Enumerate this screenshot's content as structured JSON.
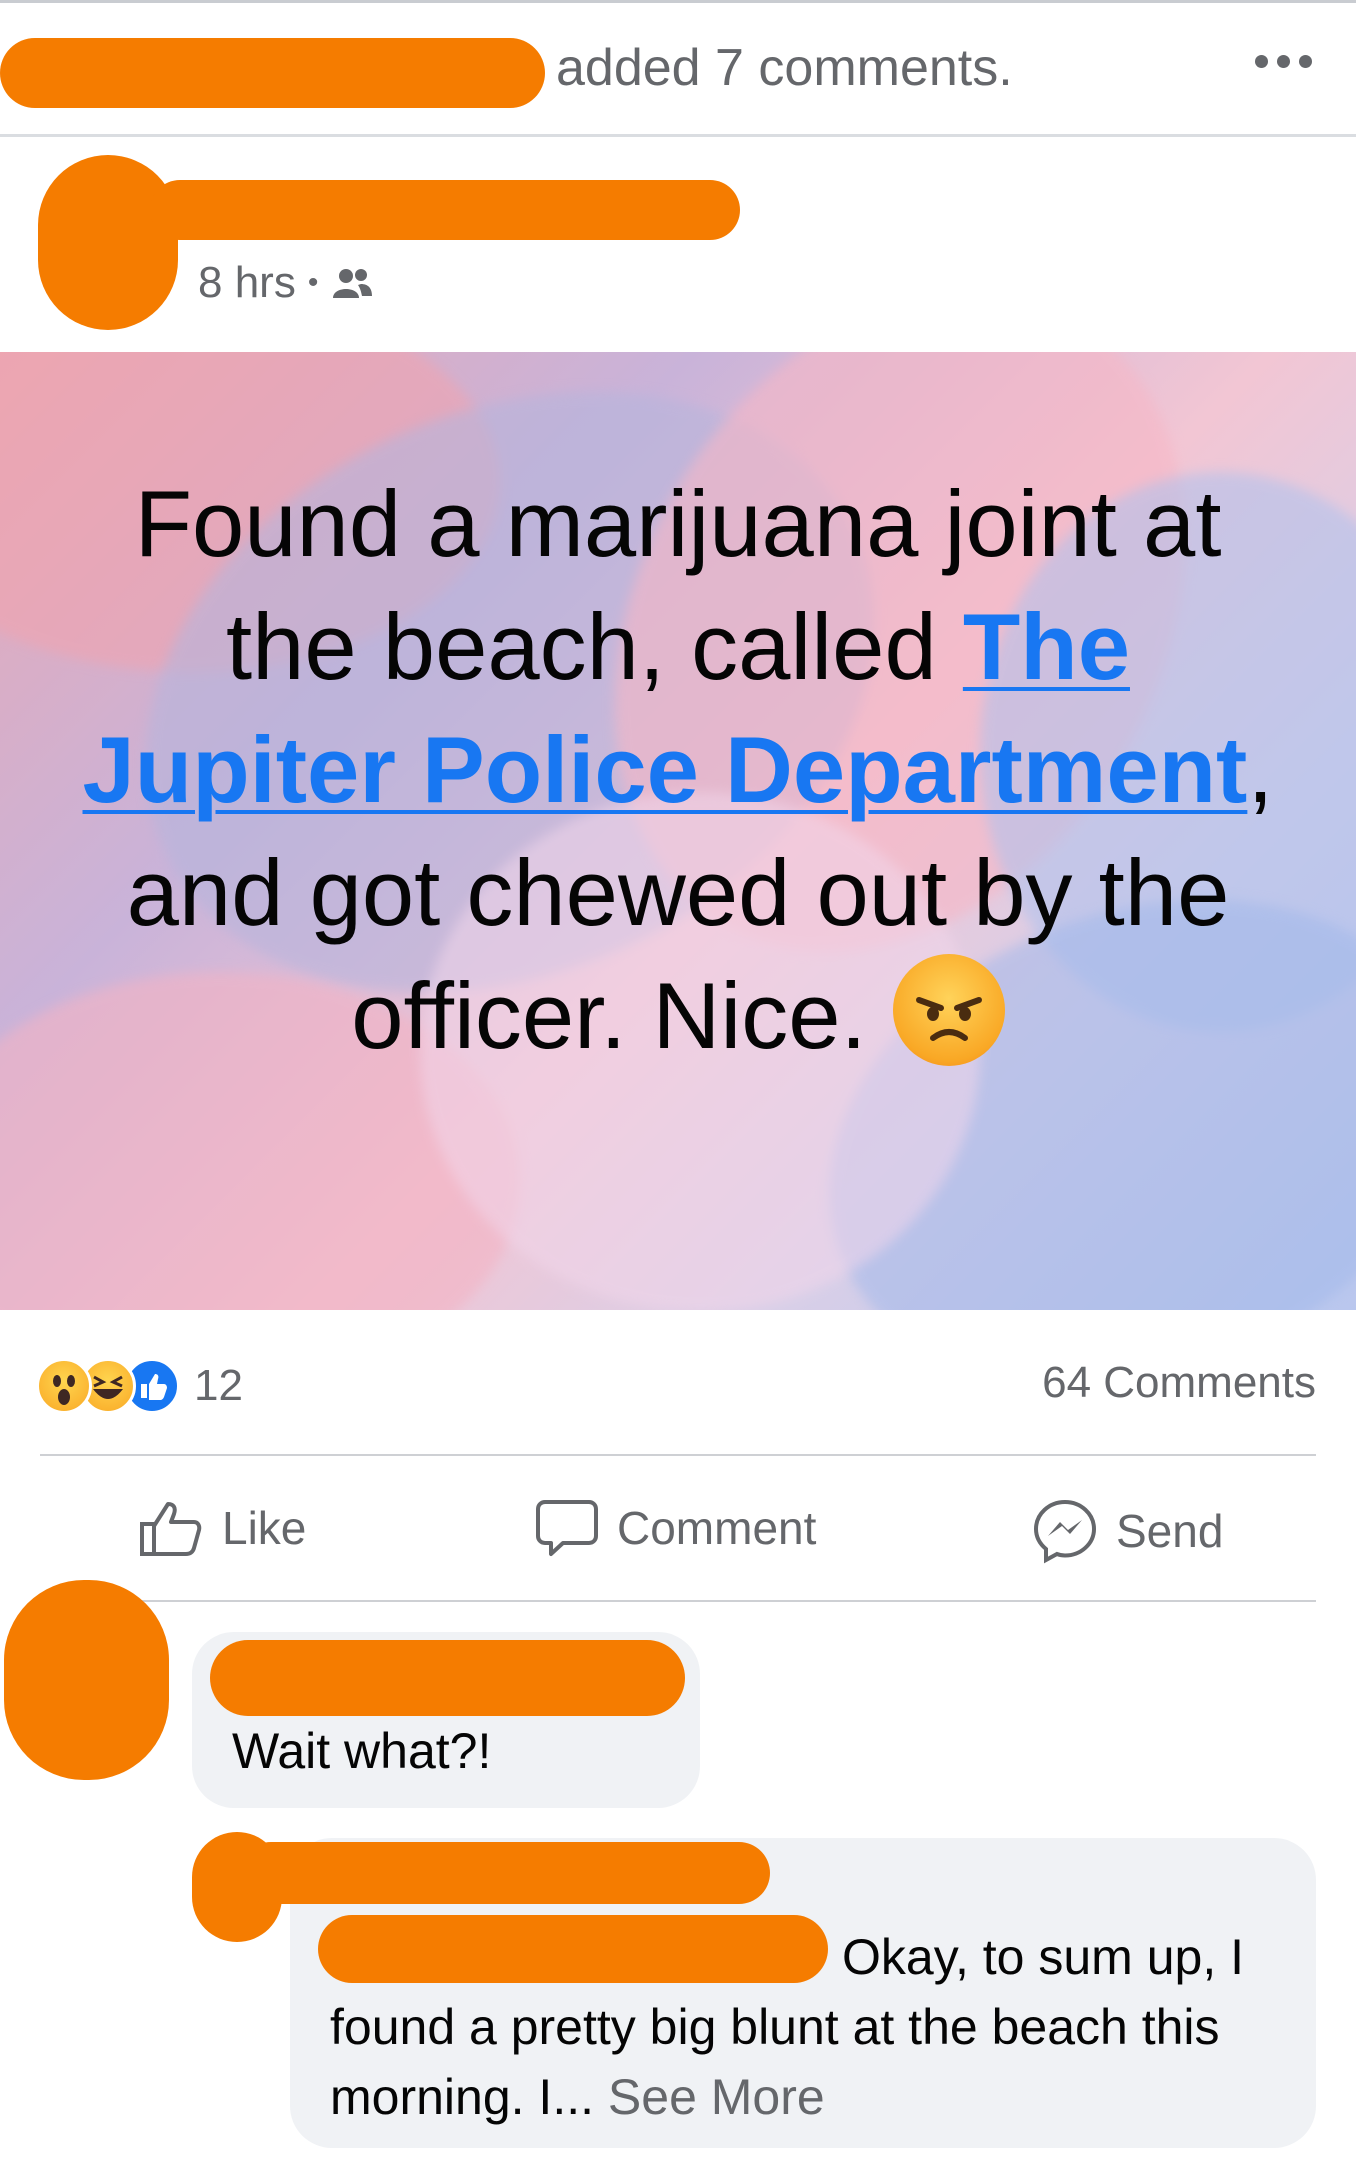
{
  "header": {
    "text": "added 7 comments."
  },
  "post": {
    "time": "8 hrs",
    "audience_icon": "friends-icon",
    "text_before": "Found a marijuana joint at the beach, called ",
    "link": "The Jupiter Police Department",
    "text_after": ", and got chewed out by the officer. Nice.",
    "emoji": "angry-face"
  },
  "reactions": {
    "types": [
      "wow",
      "haha",
      "like"
    ],
    "count": "12"
  },
  "comments_count": "64 Comments",
  "actions": {
    "like": "Like",
    "comment": "Comment",
    "send": "Send"
  },
  "comments": [
    {
      "text": "Wait what?!"
    },
    {
      "text": "Okay, to sum up, I found a pretty big blunt at the beach this morning. I...",
      "see_more": "See More"
    }
  ],
  "colors": {
    "link": "#1877f2",
    "redaction": "#f57c00",
    "secondary_text": "#65676b"
  }
}
